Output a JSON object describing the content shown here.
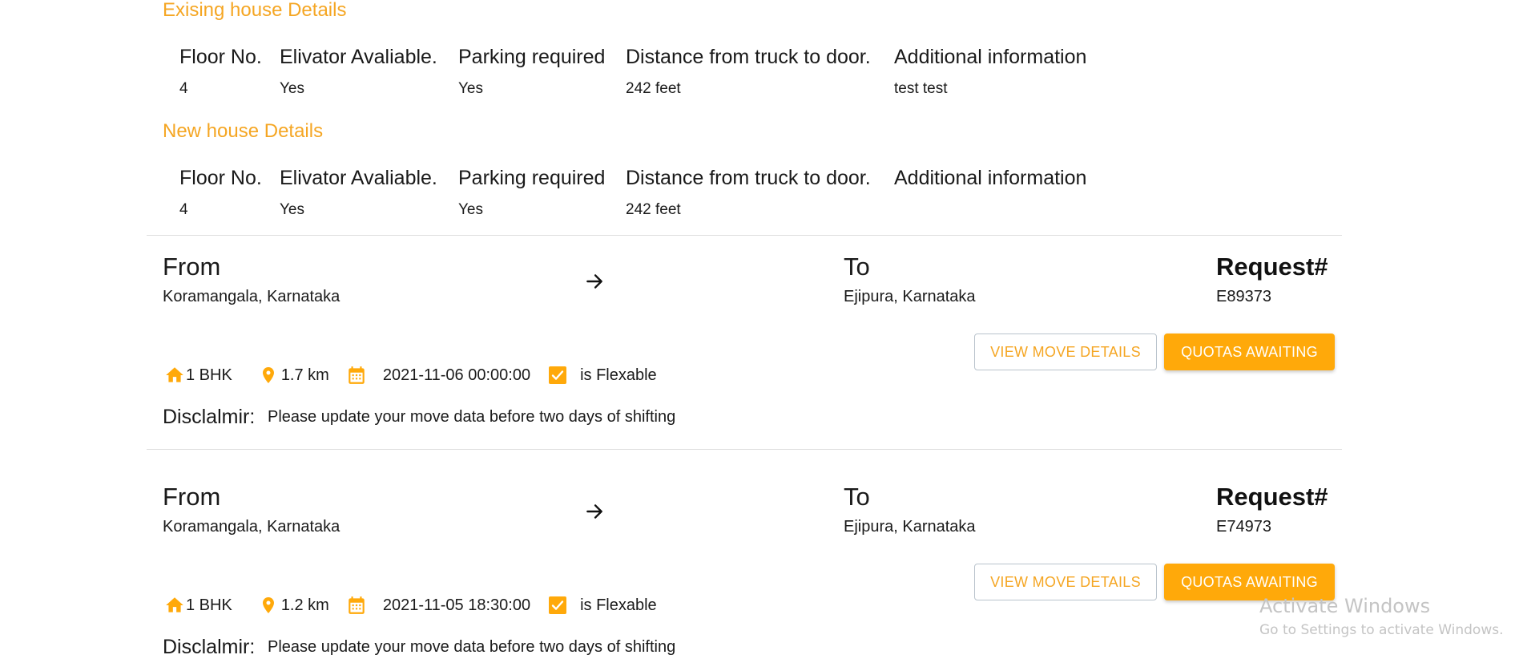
{
  "existing_house": {
    "title": "Exising house Details",
    "headers": {
      "floor": "Floor No.",
      "elevator": "Elivator Avaliable.",
      "parking": "Parking required",
      "distance": "Distance from truck to door.",
      "additional": "Additional information"
    },
    "values": {
      "floor": "4",
      "elevator": "Yes",
      "parking": "Yes",
      "distance": "242 feet",
      "additional": "test test"
    }
  },
  "new_house": {
    "title": "New house Details",
    "headers": {
      "floor": "Floor No.",
      "elevator": "Elivator Avaliable.",
      "parking": "Parking required",
      "distance": "Distance from truck to door.",
      "additional": "Additional information"
    },
    "values": {
      "floor": "4",
      "elevator": "Yes",
      "parking": "Yes",
      "distance": "242 feet",
      "additional": ""
    }
  },
  "requests": [
    {
      "from_label": "From",
      "from_value": "Koramangala, Karnataka",
      "to_label": "To",
      "to_value": "Ejipura, Karnataka",
      "request_label": "Request#",
      "request_id": "E89373",
      "home_type": "1 BHK",
      "distance": "1.7 km",
      "datetime": "2021-11-06 00:00:00",
      "flexible_label": "is Flexable",
      "flexible_checked": true,
      "view_button": "VIEW MOVE DETAILS",
      "quotas_button": "QUOTAS AWAITING",
      "disclaimer_label": "Disclalmir:",
      "disclaimer_text": "Please update your move data before two days of shifting"
    },
    {
      "from_label": "From",
      "from_value": "Koramangala, Karnataka",
      "to_label": "To",
      "to_value": "Ejipura, Karnataka",
      "request_label": "Request#",
      "request_id": "E74973",
      "home_type": "1 BHK",
      "distance": "1.2 km",
      "datetime": "2021-11-05 18:30:00",
      "flexible_label": "is Flexable",
      "flexible_checked": true,
      "view_button": "VIEW MOVE DETAILS",
      "quotas_button": "QUOTAS AWAITING",
      "disclaimer_label": "Disclalmir:",
      "disclaimer_text": "Please update your move data before two days of shifting"
    }
  ],
  "watermark": {
    "title": "Activate Windows",
    "subtitle": "Go to Settings to activate Windows."
  },
  "colors": {
    "accent": "#f5a623",
    "button_fill": "#ffa90a",
    "divider": "#dddddd"
  },
  "icons": [
    "home-icon",
    "location-pin-icon",
    "calendar-icon",
    "checkbox-checked-icon",
    "arrow-right-icon"
  ]
}
